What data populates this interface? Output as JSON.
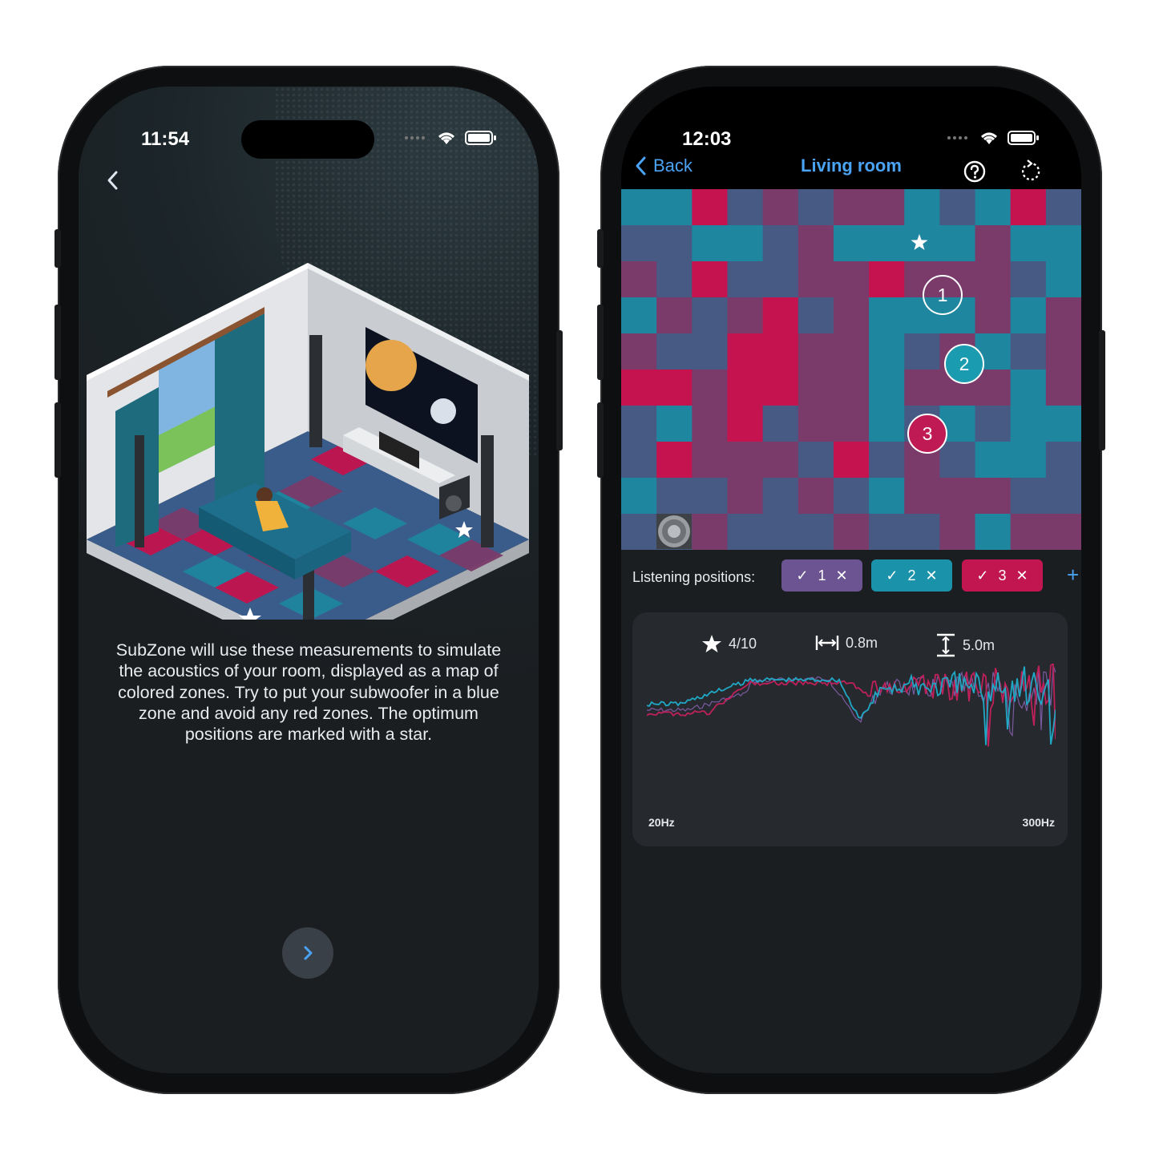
{
  "left_screen": {
    "status": {
      "time": "11:54"
    },
    "back": {
      "icon": "chevron-left-icon"
    },
    "illustration": {
      "icon": "room-illustration"
    },
    "intro_text": "SubZone will use these measurements to simulate the acoustics of your room, displayed as a map of colored zones. Try to put your subwoofer in a blue zone and avoid any red zones. The optimum positions are marked with a star.",
    "next": {
      "icon": "chevron-right-icon"
    }
  },
  "right_screen": {
    "status": {
      "time": "12:03"
    },
    "nav": {
      "back_label": "Back",
      "title": "Living room",
      "help_icon": "question-circle-icon",
      "reset_icon": "reset-icon"
    },
    "heatmap": {
      "colors": {
        "blue": "#1f86a0",
        "red": "#c4134f",
        "purple": "#7a3b6a",
        "slate": "#465a84"
      },
      "markers": [
        "1",
        "2",
        "3"
      ],
      "marker_colors": [
        "#7b5aa0",
        "#1a9bb0",
        "#c01a55"
      ],
      "star_icon": "star-icon",
      "subwoofer_icon": "subwoofer-icon"
    },
    "listening": {
      "label": "Listening positions:",
      "chips": [
        {
          "label": "1",
          "color": "#6c5493"
        },
        {
          "label": "2",
          "color": "#1a93aa"
        },
        {
          "label": "3",
          "color": "#c1164f"
        }
      ],
      "add_label": "+"
    },
    "stats": {
      "score": "4/10",
      "width": "0.8m",
      "height": "5.0m"
    },
    "chart": {
      "xmin_label": "20Hz",
      "xmax_label": "300Hz",
      "series_colors": [
        "#1fa7c4",
        "#c0205a",
        "#7b5aa0"
      ]
    }
  }
}
